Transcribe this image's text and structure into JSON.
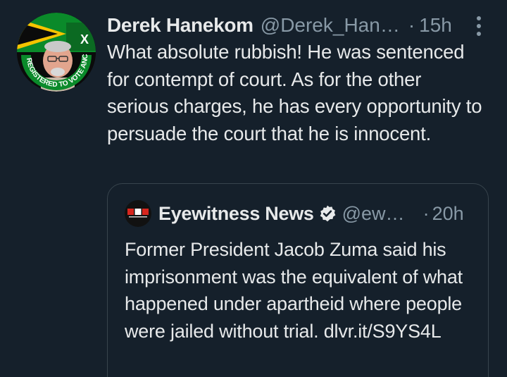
{
  "tweet": {
    "author_name": "Derek Hanekom",
    "author_handle": "@Derek_Han…",
    "separator": "·",
    "time": "15h",
    "text": "What absolute rubbish! He was sentenced for contempt of court. As for the other serious charges, he has every opportunity to persuade the court that he is innocent.",
    "avatar": {
      "icon": "avatar-photo",
      "badge_text": "REGISTERED TO VOTE ANC",
      "badge_mark": "X",
      "colors": {
        "green": "#0a8a2a",
        "yellow": "#f5c400",
        "black": "#0b0b0b"
      }
    },
    "more_icon": "more-vertical-icon"
  },
  "quoted_tweet": {
    "logo_text": "EWN",
    "author_name": "Eyewitness News",
    "verified_icon": "verified-badge-icon",
    "author_handle": "@ew…",
    "separator": "·",
    "time": "20h",
    "text": "Former President Jacob Zuma said his imprisonment was the equivalent of what happened under apartheid where people were jailed without trial. dlvr.it/S9YS4L"
  },
  "colors": {
    "background": "#15202b",
    "text_primary": "#e7e9ea",
    "text_secondary": "#8899a6",
    "border": "#38444d",
    "verified": "#e7e9ea"
  }
}
